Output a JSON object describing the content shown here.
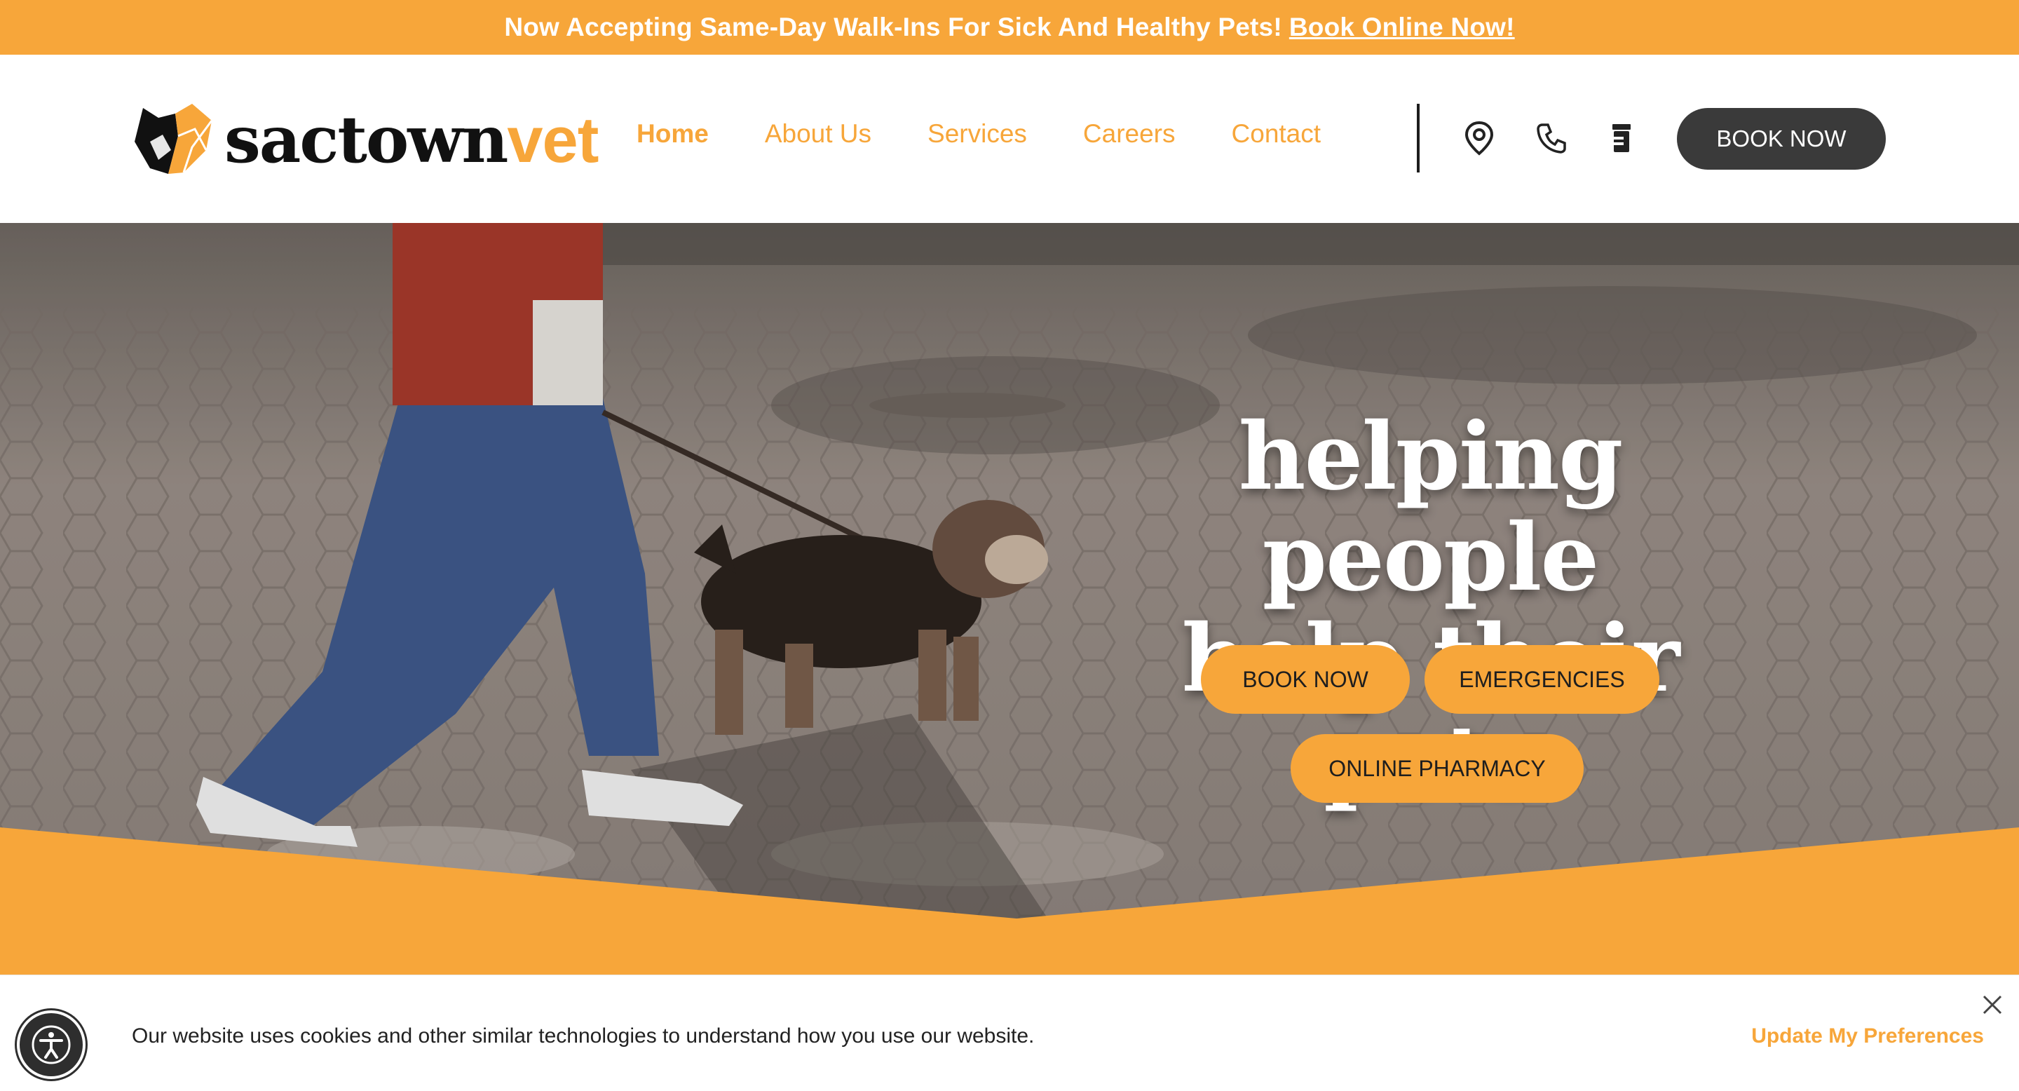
{
  "announcement": {
    "text": "Now Accepting Same-Day Walk-Ins For Sick And Healthy Pets!",
    "link": "Book Online Now!"
  },
  "brand": {
    "name_part1": "sactown",
    "name_part2": "vet",
    "accent": "#f7a63a"
  },
  "nav": {
    "items": [
      {
        "label": "Home",
        "active": true
      },
      {
        "label": "About Us"
      },
      {
        "label": "Services"
      },
      {
        "label": "Careers"
      },
      {
        "label": "Contact"
      }
    ],
    "icons": [
      "map-pin-icon",
      "phone-icon",
      "pharmacy-icon"
    ],
    "book_now": "BOOK NOW"
  },
  "hero": {
    "title_line1": "helping people",
    "title_line2": "help their pets",
    "buttons": {
      "book_now": "BOOK NOW",
      "emergencies": "EMERGENCIES",
      "pharmacy": "ONLINE PHARMACY"
    }
  },
  "cookie": {
    "text": "Our website uses cookies and other similar technologies to understand how you use our website.",
    "preferences": "Update My Preferences"
  },
  "colors": {
    "accent": "#f7a63a",
    "dark": "#3a3a3a"
  }
}
